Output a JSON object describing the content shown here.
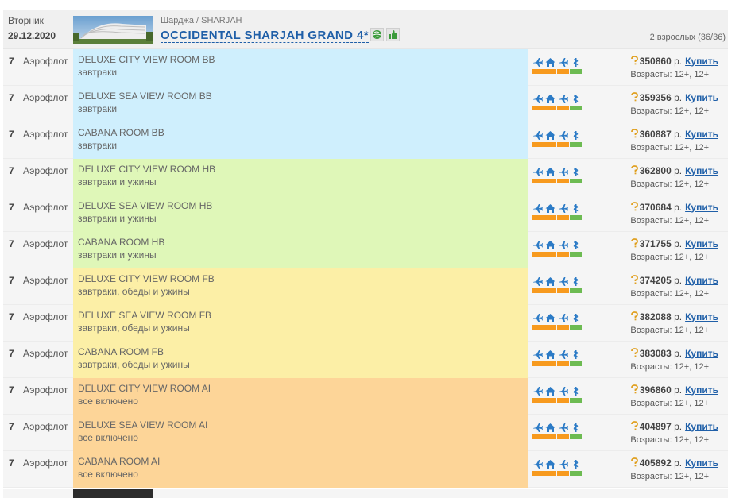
{
  "header": {
    "day": "Вторник",
    "date": "29.12.2020",
    "location": "Шарджа / SHARJAH",
    "hotel_name": "OCCIDENTAL SHARJAH GRAND 4*",
    "guests": "2 взрослых (36/36)"
  },
  "meal_colors": {
    "BB": "#cfeffd",
    "HB": "#dff7b8",
    "FB": "#fcefa6",
    "AI": "#fdd598"
  },
  "status_colors": {
    "orange": "#f79a1e",
    "green": "#6dbb52",
    "icon_blue": "#2c7bc6"
  },
  "labels": {
    "currency": "р.",
    "buy": "Купить"
  },
  "rows": [
    {
      "nights": "7",
      "airline": "Аэрофлот",
      "room": "DELUXE CITY VIEW ROOM BB",
      "meal": "завтраки",
      "meal_code": "BB",
      "price": "350860",
      "ages": "Возрасты: 12+, 12+"
    },
    {
      "nights": "7",
      "airline": "Аэрофлот",
      "room": "DELUXE SEA VIEW ROOM BB",
      "meal": "завтраки",
      "meal_code": "BB",
      "price": "359356",
      "ages": "Возрасты: 12+, 12+"
    },
    {
      "nights": "7",
      "airline": "Аэрофлот",
      "room": "CABANA ROOM BB",
      "meal": "завтраки",
      "meal_code": "BB",
      "price": "360887",
      "ages": "Возрасты: 12+, 12+"
    },
    {
      "nights": "7",
      "airline": "Аэрофлот",
      "room": "DELUXE CITY VIEW ROOM HB",
      "meal": "завтраки и ужины",
      "meal_code": "HB",
      "price": "362800",
      "ages": "Возрасты: 12+, 12+"
    },
    {
      "nights": "7",
      "airline": "Аэрофлот",
      "room": "DELUXE SEA VIEW ROOM HB",
      "meal": "завтраки и ужины",
      "meal_code": "HB",
      "price": "370684",
      "ages": "Возрасты: 12+, 12+"
    },
    {
      "nights": "7",
      "airline": "Аэрофлот",
      "room": "CABANA ROOM HB",
      "meal": "завтраки и ужины",
      "meal_code": "HB",
      "price": "371755",
      "ages": "Возрасты: 12+, 12+"
    },
    {
      "nights": "7",
      "airline": "Аэрофлот",
      "room": "DELUXE CITY VIEW ROOM FB",
      "meal": "завтраки, обеды и ужины",
      "meal_code": "FB",
      "price": "374205",
      "ages": "Возрасты: 12+, 12+"
    },
    {
      "nights": "7",
      "airline": "Аэрофлот",
      "room": "DELUXE SEA VIEW ROOM FB",
      "meal": "завтраки, обеды и ужины",
      "meal_code": "FB",
      "price": "382088",
      "ages": "Возрасты: 12+, 12+"
    },
    {
      "nights": "7",
      "airline": "Аэрофлот",
      "room": "CABANA ROOM FB",
      "meal": "завтраки, обеды и ужины",
      "meal_code": "FB",
      "price": "383083",
      "ages": "Возрасты: 12+, 12+"
    },
    {
      "nights": "7",
      "airline": "Аэрофлот",
      "room": "DELUXE CITY VIEW ROOM AI",
      "meal": "все включено",
      "meal_code": "AI",
      "price": "396860",
      "ages": "Возрасты: 12+, 12+"
    },
    {
      "nights": "7",
      "airline": "Аэрофлот",
      "room": "DELUXE SEA VIEW ROOM AI",
      "meal": "все включено",
      "meal_code": "AI",
      "price": "404897",
      "ages": "Возрасты: 12+, 12+"
    },
    {
      "nights": "7",
      "airline": "Аэрофлот",
      "room": "CABANA ROOM AI",
      "meal": "все включено",
      "meal_code": "AI",
      "price": "405892",
      "ages": "Возрасты: 12+, 12+"
    }
  ],
  "status_icons": [
    "plane-out-icon",
    "house-icon",
    "plane-back-icon",
    "medical-icon"
  ],
  "status_bars": [
    "orange",
    "orange",
    "orange",
    "green"
  ]
}
